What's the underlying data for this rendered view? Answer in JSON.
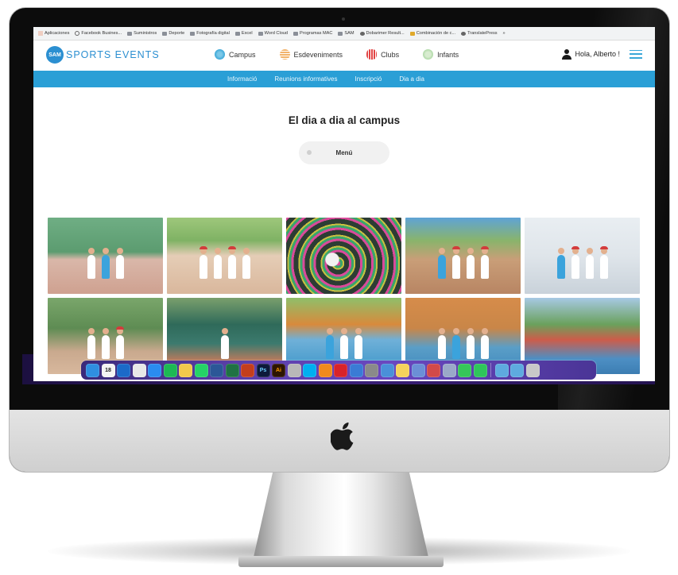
{
  "browser": {
    "bookmarks": [
      {
        "label": "Aplicaciones",
        "icon": "apps-grid-icon"
      },
      {
        "label": "Facebook Busines...",
        "icon": "facebook-icon"
      },
      {
        "label": "Suministros",
        "icon": "folder-icon"
      },
      {
        "label": "Deporte",
        "icon": "folder-icon"
      },
      {
        "label": "Fotografía digital",
        "icon": "folder-icon"
      },
      {
        "label": "Excel",
        "icon": "folder-icon"
      },
      {
        "label": "Word Cloud",
        "icon": "folder-icon"
      },
      {
        "label": "Programas MAC",
        "icon": "folder-icon"
      },
      {
        "label": "SAM",
        "icon": "folder-icon"
      },
      {
        "label": "Dobarimer Result...",
        "icon": "result-icon"
      },
      {
        "label": "Combinación de c...",
        "icon": "combination-icon"
      },
      {
        "label": "TranslatePress",
        "icon": "translatepress-icon"
      },
      {
        "label": "»",
        "icon": ""
      }
    ]
  },
  "site": {
    "logo_badge": "SAM",
    "logo_text": "SPORTS EVENTS",
    "nav": [
      {
        "label": "Campus",
        "icon": "campus-icon"
      },
      {
        "label": "Esdeveniments",
        "icon": "events-icon"
      },
      {
        "label": "Clubs",
        "icon": "clubs-icon"
      },
      {
        "label": "Infants",
        "icon": "infants-icon"
      }
    ],
    "greeting": "Hola, Alberto !",
    "subnav": [
      "Informació",
      "Reunions informatives",
      "Inscripció",
      "Dia a dia"
    ],
    "page_title": "El dia a dia al campus",
    "menu_button": "Menú",
    "photos": 10
  },
  "dock": {
    "icons": [
      {
        "name": "finder-icon",
        "color": "#2f8fe0"
      },
      {
        "name": "calendar-icon",
        "color": "#f4f4f4",
        "text": "18"
      },
      {
        "name": "outlook-icon",
        "color": "#1b6ac9"
      },
      {
        "name": "chrome-icon",
        "color": "#e8e8e8"
      },
      {
        "name": "app-store-icon",
        "color": "#2a8cf0"
      },
      {
        "name": "spotify-icon",
        "color": "#1db954"
      },
      {
        "name": "photos-icon",
        "color": "#f2c84b"
      },
      {
        "name": "whatsapp-icon",
        "color": "#25d366"
      },
      {
        "name": "word-icon",
        "color": "#2b5797"
      },
      {
        "name": "excel-icon",
        "color": "#1f7244"
      },
      {
        "name": "powerpoint-icon",
        "color": "#c43e1c"
      },
      {
        "name": "photoshop-icon",
        "color": "#0d1a3a",
        "text": "Ps"
      },
      {
        "name": "illustrator-icon",
        "color": "#2d1500",
        "text": "Ai"
      },
      {
        "name": "automator-icon",
        "color": "#b8b8b8"
      },
      {
        "name": "skype-icon",
        "color": "#00aff0"
      },
      {
        "name": "vlc-icon",
        "color": "#f08a1c"
      },
      {
        "name": "opera-icon",
        "color": "#d8232a"
      },
      {
        "name": "network-icon",
        "color": "#3a7bd5"
      },
      {
        "name": "settings-icon",
        "color": "#8a8a8a"
      },
      {
        "name": "preview-icon",
        "color": "#4a90d9"
      },
      {
        "name": "notes-icon",
        "color": "#f5d35c"
      },
      {
        "name": "files-icon",
        "color": "#6b8fd6"
      },
      {
        "name": "video-icon",
        "color": "#d24a4a"
      },
      {
        "name": "screen-icon",
        "color": "#9aa8c8"
      },
      {
        "name": "messages-icon",
        "color": "#36c759"
      },
      {
        "name": "facetime-icon",
        "color": "#2fc55b"
      },
      {
        "name": "folder-downloads-icon",
        "color": "#5eaadf"
      },
      {
        "name": "folder-docs-icon",
        "color": "#5eaadf"
      },
      {
        "name": "trash-icon",
        "color": "#c8c8c8"
      }
    ]
  }
}
